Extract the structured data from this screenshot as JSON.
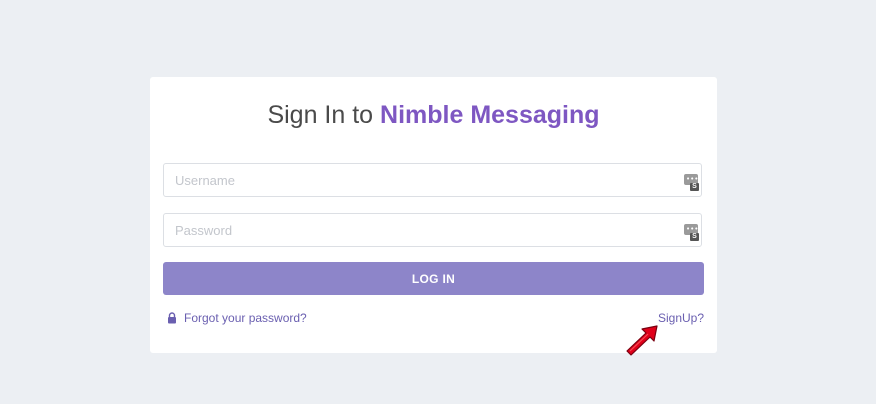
{
  "title": {
    "prefix": "Sign In to ",
    "brand": "Nimble Messaging"
  },
  "form": {
    "username_placeholder": "Username",
    "password_placeholder": "Password",
    "login_label": "LOG IN"
  },
  "links": {
    "forgot_password": "Forgot your password?",
    "signup": "SignUp?"
  },
  "password_manager_tag": "S",
  "colors": {
    "background": "#eceff3",
    "brand": "#7e57c2",
    "button": "#8d85c9",
    "link": "#6a5fb0",
    "annotation_arrow": "#e0001a"
  },
  "icons": {
    "lock": "lock-icon",
    "password_manager": "password-manager-icon",
    "annotation": "red-arrow-icon"
  }
}
